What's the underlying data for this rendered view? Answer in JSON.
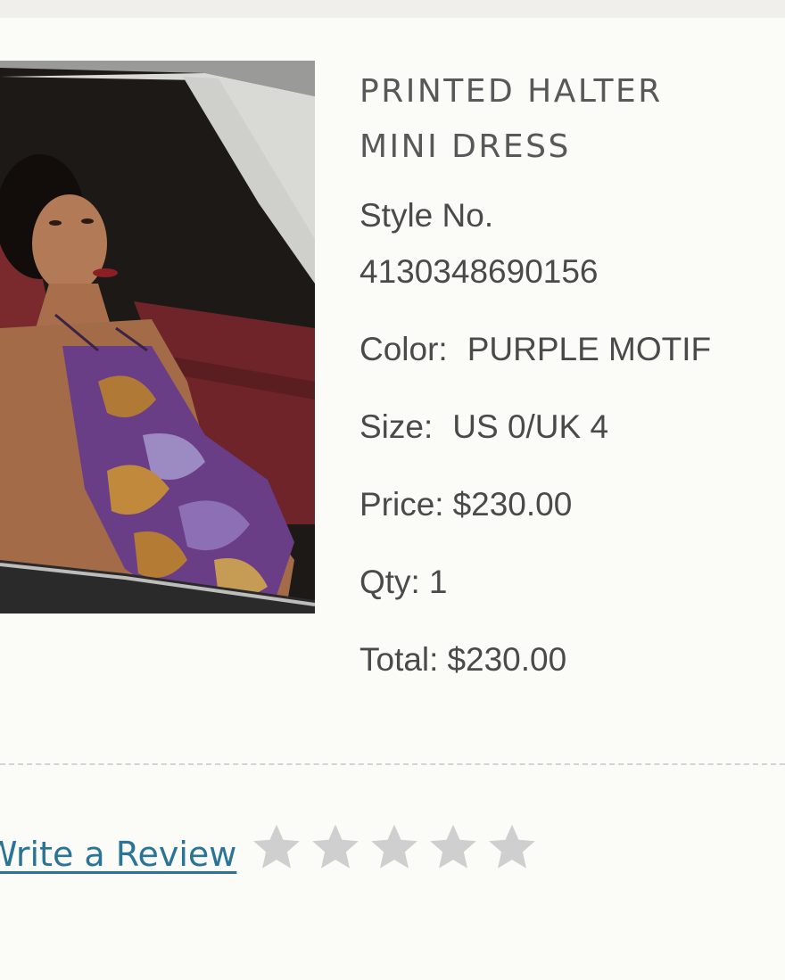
{
  "product": {
    "title_line1": "PRINTED HALTER",
    "title_line2": "MINI DRESS",
    "style_label": "Style No.",
    "style_number": "4130348690156",
    "color_label": "Color:",
    "color_value": "PURPLE MOTIF",
    "size_label": "Size:",
    "size_value": "US 0/UK 4",
    "price_label": "Price:",
    "price_value": "$230.00",
    "qty_label": "Qty:",
    "qty_value": "1",
    "total_label": "Total:",
    "total_value": "$230.00",
    "image_icon": "product-photo"
  },
  "review": {
    "link_label": "Write a Review",
    "rating": 0,
    "max_rating": 5,
    "star_icon": "star-icon"
  },
  "colors": {
    "link": "#2a7496",
    "star_empty": "#cfcfcf",
    "text": "#4a4a4a"
  }
}
